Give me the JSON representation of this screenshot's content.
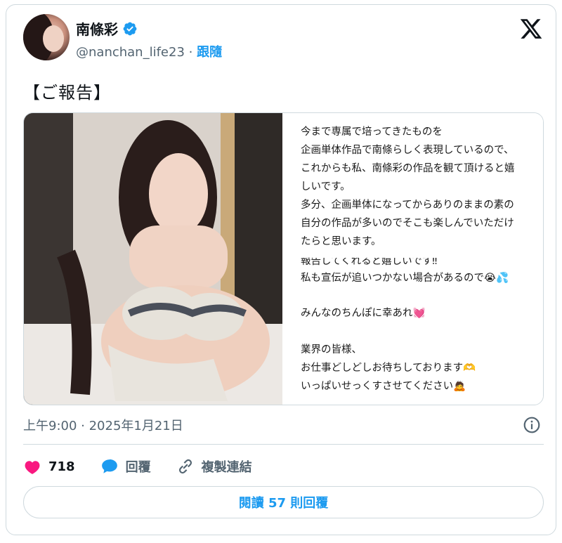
{
  "author": {
    "display_name": "南條彩",
    "handle": "@nanchan_life23",
    "separator": "·",
    "follow_label": "跟隨"
  },
  "tweet": {
    "text": "【ご報告】",
    "media_text_top": [
      "今まで専属で培ってきたものを",
      "企画単体作品で南條らしく表現しているので、",
      "これからも私、南條彩の作品を観て頂けると嬉",
      "しいです。",
      "多分、企画単体になってからありのままの素の",
      "自分の作品が多いのでそこも楽しんでいただけ",
      "たらと思います。"
    ],
    "media_text_bottom": [
      "報告してくれると嬉しいです‼",
      "私も宣伝が追いつかない場合があるので😭💦",
      "",
      "みんなのちんぽに幸あれ💓",
      "",
      "業界の皆様、",
      "お仕事どしどしお待ちしております🫶",
      "いっぱいせっくすさせてください🙇"
    ],
    "timestamp": "上午9:00 · 2025年1月21日"
  },
  "actions": {
    "like_count": "718",
    "reply_label": "回覆",
    "copy_link_label": "複製連結"
  },
  "read_replies_label": "閱讀 57 則回覆",
  "colors": {
    "accent": "#1d9bf0",
    "like": "#f91880",
    "border": "#cfd9de",
    "muted": "#536471"
  },
  "icons": [
    "verified-badge-icon",
    "x-logo-icon",
    "info-icon",
    "heart-icon",
    "reply-icon",
    "link-icon"
  ]
}
